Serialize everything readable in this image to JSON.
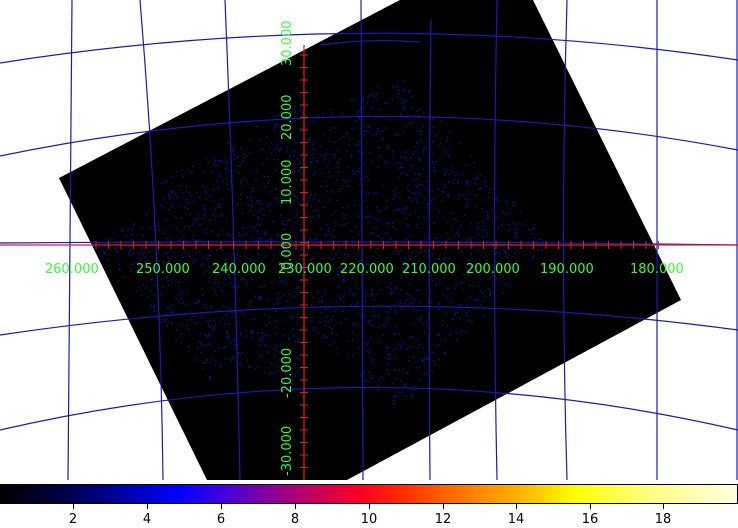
{
  "colors": {
    "grid_line": "#1a1ab8",
    "axis_line": "#e02020",
    "axis_label": "#33ff33",
    "image_background": "#000000",
    "noise_pixel": "#1010a0"
  },
  "ra_labels": [
    "260.000",
    "250.000",
    "240.000",
    "230.000",
    "220.000",
    "210.000",
    "200.000",
    "190.000",
    "180.000"
  ],
  "dec_labels": [
    "30.000",
    "20.000",
    "10.000",
    "0.000",
    "-20.000",
    "-30.000"
  ],
  "colorbar": {
    "ticks": [
      "2",
      "4",
      "6",
      "8",
      "10",
      "12",
      "14",
      "16",
      "18"
    ]
  }
}
